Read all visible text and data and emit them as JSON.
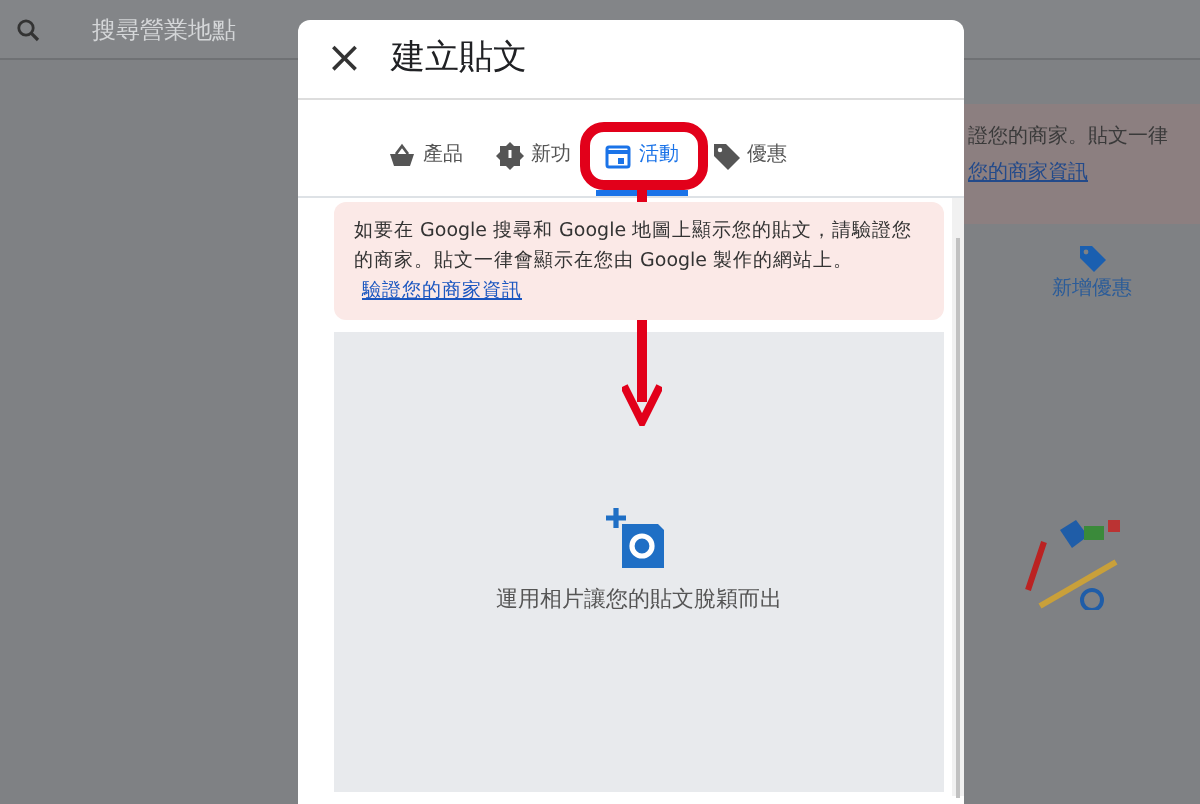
{
  "background": {
    "search": {
      "placeholder": "搜尋營業地點"
    },
    "banner": {
      "text": "證您的商家。貼文一律",
      "link": "您的商家資訊"
    },
    "offer_button": {
      "label": "新增優惠"
    }
  },
  "dialog": {
    "title": "建立貼文",
    "close": "×",
    "tabs": [
      {
        "label": "產品",
        "selected": false
      },
      {
        "label": "新功",
        "selected": false
      },
      {
        "label": "活動",
        "selected": true
      },
      {
        "label": "優惠",
        "selected": false
      }
    ],
    "notice": {
      "text": "如要在 Google 搜尋和 Google 地圖上顯示您的貼文，請驗證您的商家。貼文一律會顯示在您由 Google 製作的網站上。",
      "link": "驗證您的商家資訊"
    },
    "photo": {
      "caption": "運用相片讓您的貼文脫穎而出"
    }
  }
}
